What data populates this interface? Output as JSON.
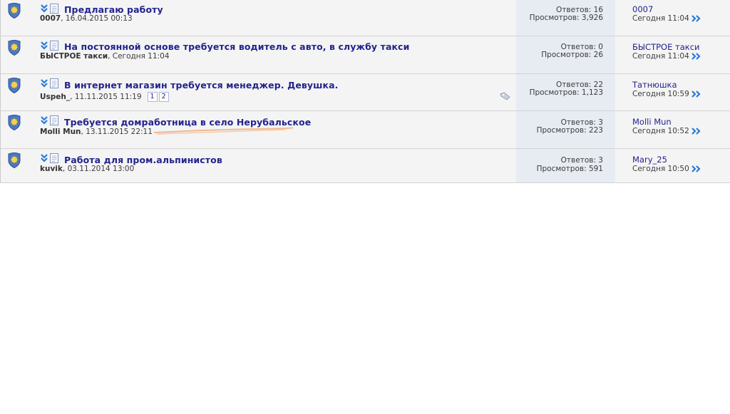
{
  "threads": [
    {
      "title": "Предлагаю работу",
      "author": "0007",
      "date": ", 16.04.2015 00:13",
      "replies_label": "Ответов: 16",
      "views_label": "Просмотров: 3,926",
      "last_user": "0007",
      "last_time": "Сегодня 11:04",
      "pages": [],
      "has_tag": false
    },
    {
      "title": "На постоянной основе требуется водитель с авто, в службу такси",
      "author": "БЫСТРОЕ такси",
      "date": ", Сегодня 11:04",
      "replies_label": "Ответов: 0",
      "views_label": "Просмотров: 26",
      "last_user": "БЫСТРОЕ такси",
      "last_time": "Сегодня 11:04",
      "pages": [],
      "has_tag": false
    },
    {
      "title": "В интернет магазин требуется менеджер. Девушка.",
      "author": "Uspeh_",
      "date": ", 11.11.2015 11:19",
      "replies_label": "Ответов: 22",
      "views_label": "Просмотров: 1,123",
      "last_user": "Татнюшка",
      "last_time": "Сегодня 10:59",
      "pages": [
        "1",
        "2"
      ],
      "has_tag": true
    },
    {
      "title": "Требуется домработница в село Нерубальское",
      "author": "Molli Mun",
      "date": ", 13.11.2015 22:11",
      "replies_label": "Ответов: 3",
      "views_label": "Просмотров: 223",
      "last_user": "Molli Mun",
      "last_time": "Сегодня 10:52",
      "pages": [],
      "has_tag": false
    },
    {
      "title": "Работа для пром.альпинистов",
      "author": "kuvik",
      "date": ", 03.11.2014 13:00",
      "replies_label": "Ответов: 3",
      "views_label": "Просмотров: 591",
      "last_user": "Mary_25",
      "last_time": "Сегодня 10:50",
      "pages": [],
      "has_tag": false
    }
  ],
  "icons": {
    "status": "forum-shield-icon",
    "first_unread": "double-chevron-down-icon",
    "thread_type": "document-icon",
    "tag": "tag-icon",
    "go_last": "double-chevron-right-icon"
  },
  "colors": {
    "link": "#23238e",
    "row_bg": "#f4f4f4",
    "stats_bg": "#e7ebf2",
    "accent_blue": "#2a7ad6",
    "underline": "#f0b890"
  }
}
